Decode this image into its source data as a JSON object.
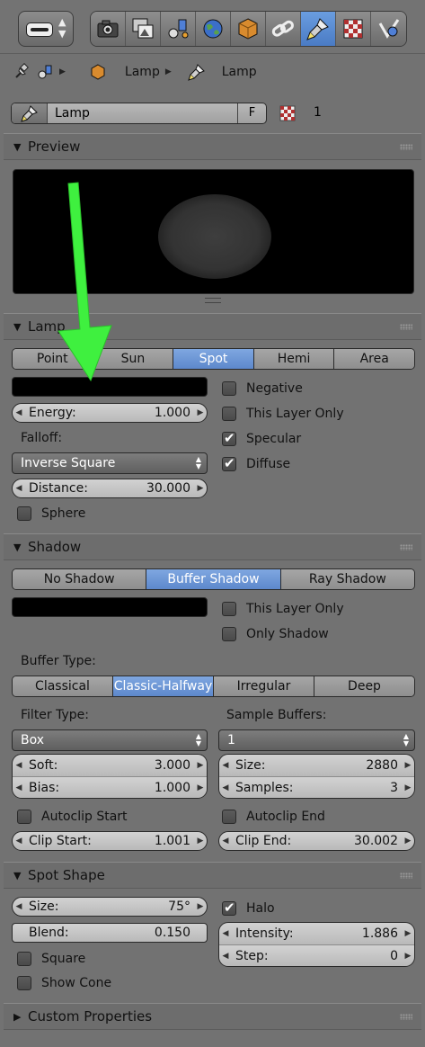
{
  "colors": {
    "selected": "#6d97d8",
    "highlight_arrow": "#3ff03f",
    "panel_bg": "#727272"
  },
  "tabs": [
    {
      "icon": "render-icon"
    },
    {
      "icon": "render-layers-icon"
    },
    {
      "icon": "scene-icon"
    },
    {
      "icon": "world-icon"
    },
    {
      "icon": "object-icon"
    },
    {
      "icon": "constraints-icon"
    },
    {
      "icon": "lamp-data-icon",
      "active": true
    },
    {
      "icon": "texture-icon"
    },
    {
      "icon": "physics-icon"
    }
  ],
  "breadcrumb": {
    "object": "Lamp",
    "data": "Lamp"
  },
  "datablock": {
    "name": "Lamp",
    "fake_user": "F",
    "users": "1"
  },
  "preview": {
    "title": "Preview"
  },
  "lamp": {
    "title": "Lamp",
    "types": [
      "Point",
      "Sun",
      "Spot",
      "Hemi",
      "Area"
    ],
    "selected_type": "Spot",
    "energy_label": "Energy:",
    "energy_value": "1.000",
    "falloff_label": "Falloff:",
    "falloff_value": "Inverse Square",
    "distance_label": "Distance:",
    "distance_value": "30.000",
    "sphere_label": "Sphere",
    "negative_label": "Negative",
    "this_layer_only_label": "This Layer Only",
    "specular_label": "Specular",
    "diffuse_label": "Diffuse"
  },
  "shadow": {
    "title": "Shadow",
    "modes": [
      "No Shadow",
      "Buffer Shadow",
      "Ray Shadow"
    ],
    "selected_mode": "Buffer Shadow",
    "this_layer_only_label": "This Layer Only",
    "only_shadow_label": "Only Shadow",
    "buffer_type_label": "Buffer Type:",
    "buffer_types": [
      "Classical",
      "Classic-Halfway",
      "Irregular",
      "Deep"
    ],
    "selected_buffer_type": "Classic-Halfway",
    "filter_type_label": "Filter Type:",
    "filter_type_value": "Box",
    "sample_buffers_label": "Sample Buffers:",
    "sample_buffers_value": "1",
    "soft_label": "Soft:",
    "soft_value": "3.000",
    "bias_label": "Bias:",
    "bias_value": "1.000",
    "size_label": "Size:",
    "size_value": "2880",
    "samples_label": "Samples:",
    "samples_value": "3",
    "autoclip_start_label": "Autoclip Start",
    "autoclip_end_label": "Autoclip End",
    "clip_start_label": "Clip Start:",
    "clip_start_value": "1.001",
    "clip_end_label": "Clip End:",
    "clip_end_value": "30.002"
  },
  "spot_shape": {
    "title": "Spot Shape",
    "size_label": "Size:",
    "size_value": "75°",
    "blend_label": "Blend:",
    "blend_value": "0.150",
    "square_label": "Square",
    "show_cone_label": "Show Cone",
    "halo_label": "Halo",
    "intensity_label": "Intensity:",
    "intensity_value": "1.886",
    "step_label": "Step:",
    "step_value": "0"
  },
  "custom_properties": {
    "title": "Custom Properties"
  }
}
